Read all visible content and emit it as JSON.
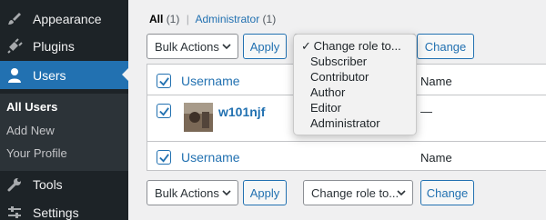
{
  "sidebar": {
    "items": [
      {
        "label": "Appearance",
        "icon": "paintbrush-icon"
      },
      {
        "label": "Plugins",
        "icon": "plug-icon"
      },
      {
        "label": "Users",
        "icon": "user-icon"
      },
      {
        "label": "Tools",
        "icon": "wrench-icon"
      },
      {
        "label": "Settings",
        "icon": "settings-sliders-icon"
      }
    ],
    "submenu": [
      "All Users",
      "Add New",
      "Your Profile"
    ]
  },
  "views": {
    "all_label": "All",
    "all_count": "(1)",
    "separator": "|",
    "admin_label": "Administrator",
    "admin_count": "(1)"
  },
  "top_actions": {
    "bulk_label": "Bulk Actions",
    "apply_label": "Apply",
    "change_label": "Change"
  },
  "bottom_actions": {
    "bulk_label": "Bulk Actions",
    "apply_label": "Apply",
    "role_label": "Change role to...",
    "change_label": "Change"
  },
  "table": {
    "columns": {
      "username": "Username",
      "name": "Name"
    },
    "rows": [
      {
        "username": "w101njf",
        "name": "—"
      }
    ],
    "footer": {
      "username": "Username",
      "name": "Name"
    }
  },
  "role_dropdown": {
    "selected": "Change role to...",
    "options": [
      "Subscriber",
      "Contributor",
      "Author",
      "Editor",
      "Administrator"
    ]
  },
  "colors": {
    "accent": "#2271b1",
    "sidebar": "#1d2327",
    "submenu": "#2c3338"
  }
}
